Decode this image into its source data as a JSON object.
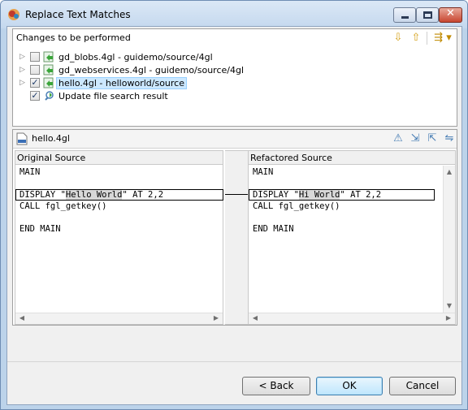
{
  "window": {
    "title": "Replace Text Matches"
  },
  "changes_panel": {
    "title": "Changes to be performed",
    "items": [
      {
        "label": "gd_blobs.4gl - guidemo/source/4gl",
        "checked": false,
        "expandable": true
      },
      {
        "label": "gd_webservices.4gl - guidemo/source/4gl",
        "checked": false,
        "expandable": true
      },
      {
        "label": "hello.4gl - helloworld/source",
        "checked": true,
        "expandable": true,
        "selected": true
      },
      {
        "label": "Update file search result",
        "checked": true,
        "expandable": false
      }
    ]
  },
  "compare": {
    "file_name": "hello.4gl",
    "left_title": "Original Source",
    "right_title": "Refactored Source",
    "left_lines": [
      "MAIN",
      "",
      "DISPLAY \"Hello World\" AT 2,2",
      "CALL fgl_getkey()",
      "",
      "END MAIN"
    ],
    "right_lines": [
      "MAIN",
      "",
      "DISPLAY \"Hi World\" AT 2,2",
      "CALL fgl_getkey()",
      "",
      "END MAIN"
    ],
    "left_changed": {
      "before": "DISPLAY \"",
      "word": "Hello World",
      "after": "\" AT 2,2"
    },
    "right_changed": {
      "before": "DISPLAY \"",
      "word": "Hi World",
      "after": "\" AT 2,2"
    }
  },
  "buttons": {
    "back": "< Back",
    "ok": "OK",
    "cancel": "Cancel"
  },
  "icons": {
    "app": "eclipse-icon",
    "next_change": "arrow-down-icon",
    "prev_change": "arrow-up-icon",
    "filter": "filter-menu-icon"
  },
  "colors": {
    "titlebar": "#c4d8ee",
    "selection": "#cce8ff",
    "default_button": "#bee6fd"
  }
}
